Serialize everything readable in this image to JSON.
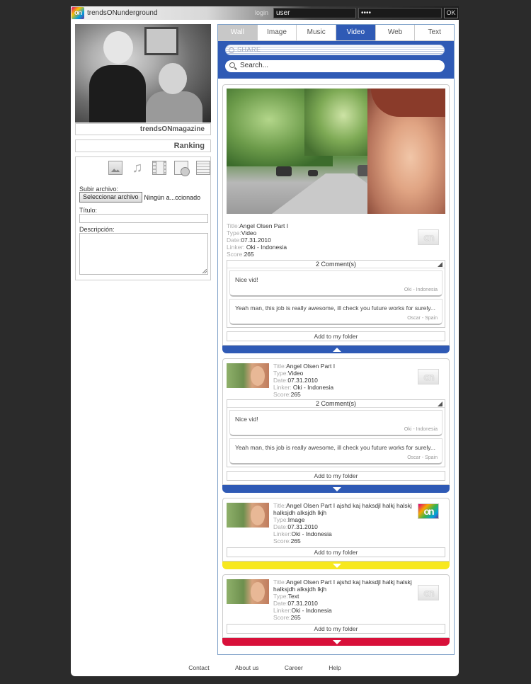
{
  "topbar": {
    "logo_text": "on",
    "brand": "trendsONunderground",
    "login_label": "login",
    "username_value": "user",
    "password_value": "••••",
    "ok_label": "OK"
  },
  "profile": {
    "caption": "trendsONmagazine",
    "ranking": "Ranking"
  },
  "upload": {
    "icons": [
      "image-icon",
      "music-icon",
      "film-icon",
      "web-icon",
      "text-icon"
    ],
    "file_label": "Subir archivo:",
    "file_button": "Seleccionar archivo",
    "file_name": "Ningún a...ccionado",
    "title_label": "Título:",
    "description_label": "Descripción:"
  },
  "tabs": [
    {
      "label": "Wall"
    },
    {
      "label": "Image"
    },
    {
      "label": "Music"
    },
    {
      "label": "Video"
    },
    {
      "label": "Web"
    },
    {
      "label": "Text"
    }
  ],
  "share": {
    "label": "SHARE"
  },
  "search": {
    "placeholder": "Search..."
  },
  "keys": {
    "title": "Title:",
    "type": "Type:",
    "date": "Date:",
    "linker": "Linker:",
    "score": "Score:"
  },
  "feed": [
    {
      "title": "Angel Olsen Part I",
      "type": "Video",
      "date": "07.31.2010",
      "linker": " Oki - Indonesia",
      "score": "265",
      "badge": "on",
      "comments_header": "2 Comment(s)",
      "comments": [
        {
          "text": "Nice vid!",
          "author": "Oki - Indonesia"
        },
        {
          "text": "Yeah man, this job is really awesome, ill check you future works for surely...",
          "author": "Oscar - Spain"
        }
      ],
      "add_label": "Add to my folder",
      "accent": "#2f5ab5"
    },
    {
      "title": "Angel Olsen Part I",
      "type": "Video",
      "date": "07.31.2010",
      "linker": " Oki - Indonesia",
      "score": "265",
      "badge": "on",
      "comments_header": "2 Comment(s)",
      "comments": [
        {
          "text": "Nice vid!",
          "author": "Oki - Indonesia"
        },
        {
          "text": "Yeah man, this job is really awesome, ill check you future works for surely...",
          "author": "Oscar - Spain"
        }
      ],
      "add_label": "Add to my folder",
      "accent": "#2f5ab5"
    },
    {
      "title": "Angel Olsen Part I ajshd kaj haksdjl halkj halskj halksjdh alksjdh lkjh",
      "type": "Image",
      "date": "07.31.2010",
      "linker": "Oki - Indonesia",
      "score": "265",
      "badge": "on",
      "add_label": "Add to my folder",
      "accent": "#f7e81e"
    },
    {
      "title": "Angel Olsen Part I ajshd kaj haksdjl halkj halskj halksjdh alksjdh lkjh",
      "type": "Text",
      "date": "07.31.2010",
      "linker": "Oki - Indonesia",
      "score": "265",
      "badge": "on",
      "add_label": "Add to my folder",
      "accent": "#d8103a"
    }
  ],
  "footer": {
    "links": [
      "Contact",
      "About us",
      "Career",
      "Help"
    ]
  }
}
